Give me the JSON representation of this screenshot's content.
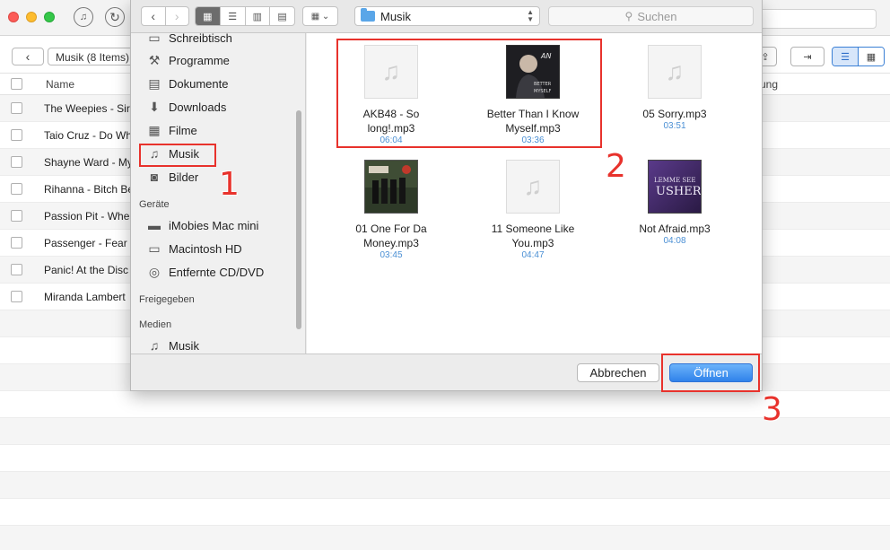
{
  "bg_app": {
    "breadcrumb": "Musik (8 Items)",
    "col_name": "Name",
    "col_right": "ung",
    "rows": [
      "The Weepies - Sire",
      "Taio Cruz - Do Wh",
      "Shayne Ward - My",
      "Rihanna - Bitch Be",
      "Passion Pit - Whe",
      "Passenger - Fear",
      "Panic! At the Disc",
      "Miranda Lambert"
    ]
  },
  "dialog": {
    "path_label": "Musik",
    "search_placeholder": "Suchen",
    "sidebar": {
      "partial_top": "Schreibtisch",
      "favorites": [
        "Programme",
        "Dokumente",
        "Downloads",
        "Filme",
        "Musik",
        "Bilder"
      ],
      "devices_header": "Geräte",
      "devices": [
        "iMobies Mac mini",
        "Macintosh HD",
        "Entfernte CD/DVD"
      ],
      "shared_header": "Freigegeben",
      "media_header": "Medien",
      "media": [
        "Musik"
      ]
    },
    "files": [
      {
        "name_line1": "AKB48 - So",
        "name_line2": "long!.mp3",
        "duration": "06:04",
        "art": "none"
      },
      {
        "name_line1": "Better Than I Know",
        "name_line2": "Myself.mp3",
        "duration": "03:36",
        "art": "adam"
      },
      {
        "name_line1": "05 Sorry.mp3",
        "name_line2": "",
        "duration": "03:51",
        "art": "none"
      },
      {
        "name_line1": "01 One For Da",
        "name_line2": "Money.mp3",
        "duration": "03:45",
        "art": "band"
      },
      {
        "name_line1": "11 Someone Like",
        "name_line2": "You.mp3",
        "duration": "04:47",
        "art": "none"
      },
      {
        "name_line1": "Not Afraid.mp3",
        "name_line2": "",
        "duration": "04:08",
        "art": "usher"
      }
    ],
    "cancel_label": "Abbrechen",
    "open_label": "Öffnen"
  },
  "annotations": [
    "1",
    "2",
    "3"
  ],
  "colors": {
    "annotation_red": "#e8322c",
    "accent_blue": "#2f82ea"
  }
}
